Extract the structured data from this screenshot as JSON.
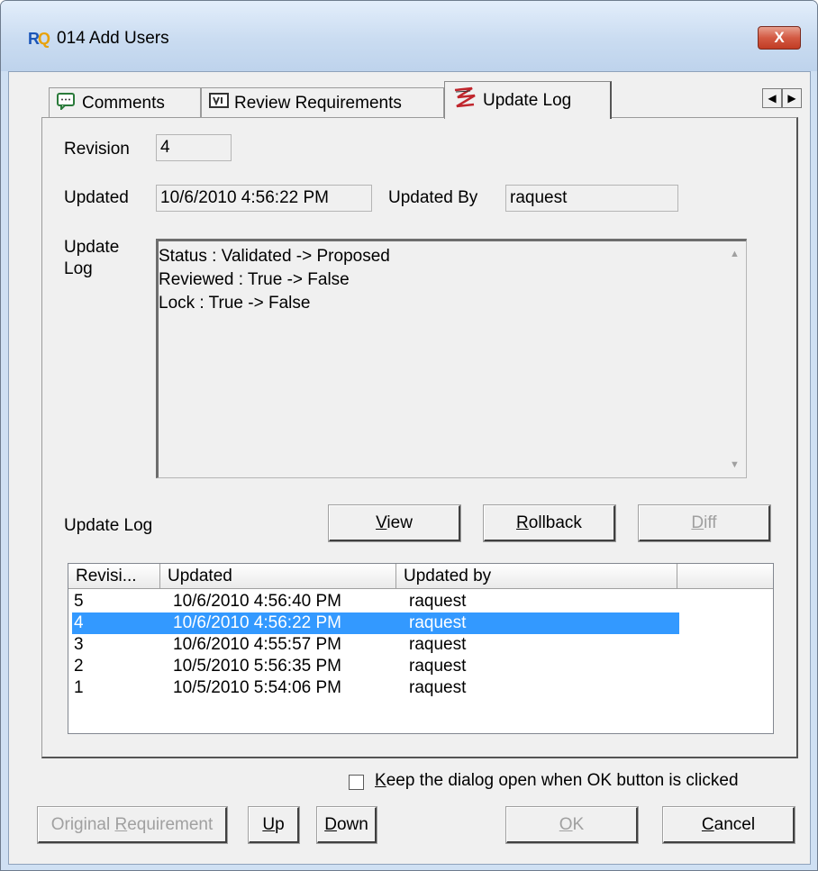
{
  "window": {
    "title": "014 Add Users",
    "icon": "app-logo-icon",
    "close_glyph": "X"
  },
  "tabs": [
    {
      "label": "Comments",
      "icon": "comment-icon"
    },
    {
      "label": "Review Requirements",
      "icon": "review-icon"
    },
    {
      "label": "Update Log",
      "icon": "update-log-icon",
      "active": true
    }
  ],
  "fields": {
    "revision_label": "Revision",
    "revision_value": "4",
    "updated_label": "Updated",
    "updated_value": "10/6/2010 4:56:22 PM",
    "updated_by_label": "Updated By",
    "updated_by_value": "raquest",
    "update_log_label_line1": "Update",
    "update_log_label_line2": "Log",
    "log_lines": [
      "Status : Validated -> Proposed",
      "Reviewed : True -> False",
      "Lock : True -> False"
    ]
  },
  "history": {
    "label": "Update Log",
    "buttons": {
      "view_prefix": "",
      "view_mnemonic": "V",
      "view_rest": "iew",
      "rollback_mnemonic": "R",
      "rollback_rest": "ollback",
      "diff_mnemonic": "D",
      "diff_rest": "iff"
    },
    "columns": [
      "Revisi...",
      "Updated",
      "Updated by",
      ""
    ],
    "rows": [
      {
        "revision": "5",
        "updated": "10/6/2010 4:56:40 PM",
        "by": "raquest"
      },
      {
        "revision": "4",
        "updated": "10/6/2010 4:56:22 PM",
        "by": "raquest",
        "selected": true
      },
      {
        "revision": "3",
        "updated": "10/6/2010 4:55:57 PM",
        "by": "raquest"
      },
      {
        "revision": "2",
        "updated": "10/5/2010 5:56:35 PM",
        "by": "raquest"
      },
      {
        "revision": "1",
        "updated": "10/5/2010 5:54:06 PM",
        "by": "raquest"
      }
    ]
  },
  "footer": {
    "keep_open_mnemonic": "K",
    "keep_open_rest": "eep the dialog open when OK button is clicked",
    "keep_open_checked": false,
    "original_req_prefix": "Original ",
    "original_req_mnemonic": "R",
    "original_req_rest": "equirement",
    "up_mnemonic": "U",
    "up_rest": "p",
    "down_mnemonic": "D",
    "down_rest": "own",
    "ok_mnemonic": "O",
    "ok_rest": "K",
    "cancel_mnemonic": "C",
    "cancel_rest": "ancel"
  },
  "colors": {
    "selection": "#3399ff",
    "title_bar": "#cadcf1",
    "close_button": "#c13c24"
  }
}
